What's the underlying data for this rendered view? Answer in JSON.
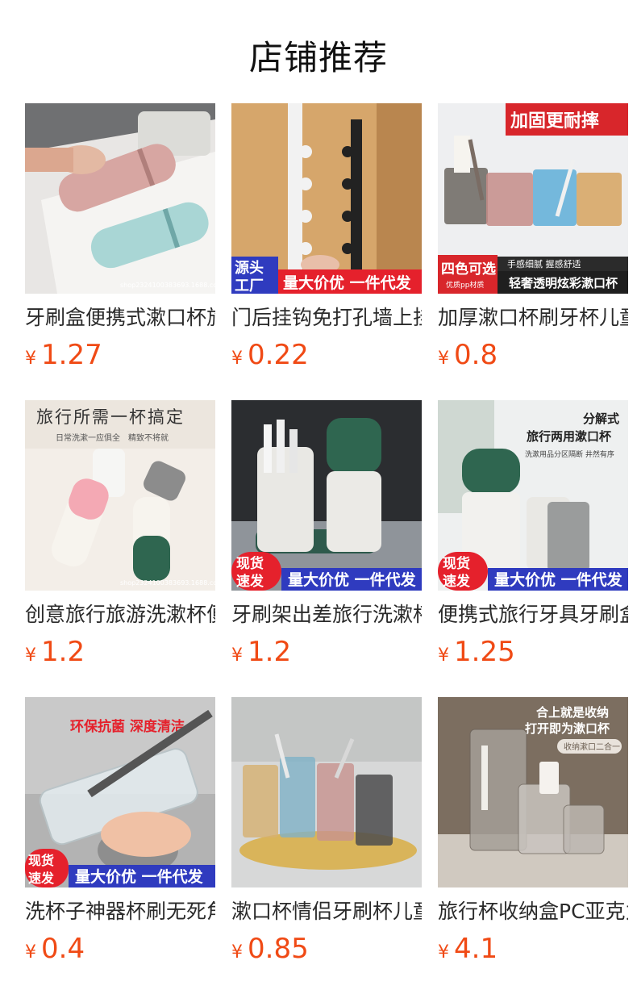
{
  "header": {
    "title": "店铺推荐"
  },
  "products": [
    {
      "name": "牙刷盒便携式漱口杯旅行",
      "currency": "¥",
      "price": "1.27",
      "overlay": {
        "watermark": "shop2324100383693.1688.com"
      }
    },
    {
      "name": "门后挂钩免打孔墙上挂",
      "currency": "¥",
      "price": "0.22",
      "overlay": {
        "corner": "源头工厂",
        "corner_a": "源头",
        "corner_b": "工厂",
        "banner": "量大价优 一件代发"
      }
    },
    {
      "name": "加厚漱口杯刷牙杯儿童",
      "currency": "¥",
      "price": "0.8",
      "overlay": {
        "top_badge": "加固更耐摔",
        "corner": "四色可选",
        "corner_sub": "优质pp材质",
        "line1": "手感细腻 握感舒适",
        "line2": "轻奢透明炫彩漱口杯"
      }
    },
    {
      "name": "创意旅行旅游洗漱杯便携",
      "currency": "¥",
      "price": "1.2",
      "overlay": {
        "headline": "旅行所需一杯搞定",
        "sub": "日常洗漱一应俱全　精致不将就",
        "watermark": "shop2324100383693.1688.com"
      }
    },
    {
      "name": "牙刷架出差旅行洗漱杯套",
      "currency": "¥",
      "price": "1.2",
      "overlay": {
        "corner_a": "现货",
        "corner_b": "速发",
        "banner": "量大价优 一件代发"
      }
    },
    {
      "name": "便携式旅行牙具牙刷盒",
      "currency": "¥",
      "price": "1.25",
      "overlay": {
        "line1": "分解式",
        "line2": "旅行两用漱口杯",
        "line3": "洗漱用品分区隔断 井然有序",
        "corner_a": "现货",
        "corner_b": "速发",
        "banner": "量大价优 一件代发"
      }
    },
    {
      "name": "洗杯子神器杯刷无死角",
      "currency": "¥",
      "price": "0.4",
      "overlay": {
        "headline": "环保抗菌 深度清洁",
        "corner_a": "现货",
        "corner_b": "速发",
        "banner": "量大价优 一件代发"
      }
    },
    {
      "name": "漱口杯情侣牙刷杯儿童",
      "currency": "¥",
      "price": "0.85",
      "overlay": {}
    },
    {
      "name": "旅行杯收纳盒PC亚克力",
      "currency": "¥",
      "price": "4.1",
      "overlay": {
        "line1": "合上就是收纳",
        "line2": "打开即为漱口杯",
        "tag": "收纳漱口二合一"
      }
    }
  ]
}
